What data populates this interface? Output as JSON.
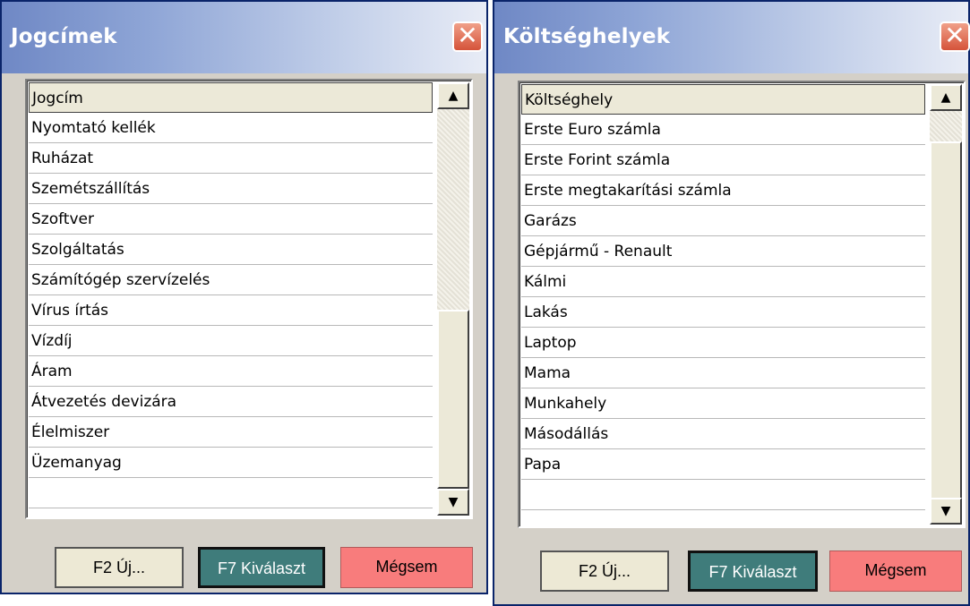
{
  "left_dialog": {
    "title": "Jogcímek",
    "close_glyph": "✕",
    "list": {
      "header": "Jogcím",
      "items": [
        "Nyomtató kellék",
        "Ruházat",
        "Szemétszállítás",
        "Szoftver",
        "Szolgáltatás",
        "Számítógép szervízelés",
        "Vírus írtás",
        "Vízdíj",
        "Áram",
        "Átvezetés devizára",
        "Élelmiszer",
        "Üzemanyag"
      ]
    },
    "buttons": {
      "new": "F2 Új...",
      "select": "F7 Kiválaszt",
      "cancel": "Mégsem"
    }
  },
  "right_dialog": {
    "title": "Költséghelyek",
    "close_glyph": "✕",
    "list": {
      "header": "Költséghely",
      "items": [
        "Erste Euro számla",
        "Erste Forint számla",
        "Erste megtakarítási számla",
        "Garázs",
        "Gépjármű - Renault",
        "Kálmi",
        "Lakás",
        "Laptop",
        "Mama",
        "Munkahely",
        "Másodállás",
        "Papa"
      ]
    },
    "buttons": {
      "new": "F2 Új...",
      "select": "F7 Kiválaszt",
      "cancel": "Mégsem"
    }
  },
  "scroll_icons": {
    "up": "▲",
    "down": "▼"
  },
  "colors": {
    "select_button": "#3f7c7b",
    "cancel_button": "#f87c7c",
    "new_button": "#ede9d5",
    "close_button": "#d5533a",
    "dialog_face": "#d4d0c8"
  }
}
